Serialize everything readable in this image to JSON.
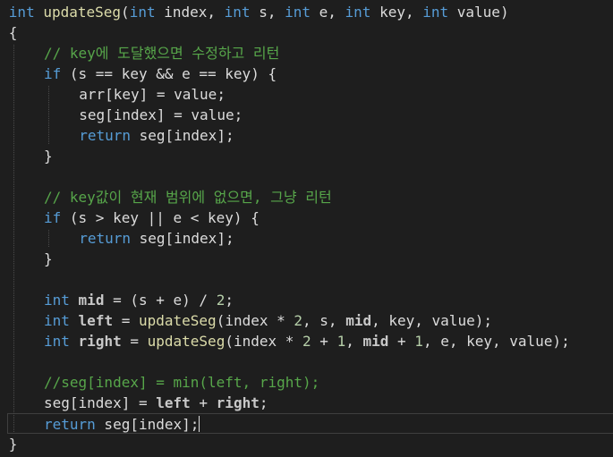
{
  "editor": {
    "lines": [
      {
        "indent": 1,
        "tokens": [
          {
            "t": "int",
            "c": "kw"
          },
          {
            "t": " ",
            "c": "pl"
          },
          {
            "t": "updateSeg",
            "c": "fn"
          },
          {
            "t": "(",
            "c": "pl"
          },
          {
            "t": "int",
            "c": "kw"
          },
          {
            "t": " index, ",
            "c": "pl"
          },
          {
            "t": "int",
            "c": "kw"
          },
          {
            "t": " s, ",
            "c": "pl"
          },
          {
            "t": "int",
            "c": "kw"
          },
          {
            "t": " e, ",
            "c": "pl"
          },
          {
            "t": "int",
            "c": "kw"
          },
          {
            "t": " key, ",
            "c": "pl"
          },
          {
            "t": "int",
            "c": "kw"
          },
          {
            "t": " value)",
            "c": "pl"
          }
        ]
      },
      {
        "indent": 1,
        "tokens": [
          {
            "t": "{",
            "c": "pl"
          }
        ]
      },
      {
        "indent": 5,
        "tokens": [
          {
            "t": "// key에 도달했으면 수정하고 리턴",
            "c": "cm"
          }
        ]
      },
      {
        "indent": 5,
        "tokens": [
          {
            "t": "if",
            "c": "kw"
          },
          {
            "t": " (s == key && e == key) {",
            "c": "pl"
          }
        ]
      },
      {
        "indent": 9,
        "tokens": [
          {
            "t": "arr[key] = value;",
            "c": "pl"
          }
        ]
      },
      {
        "indent": 9,
        "tokens": [
          {
            "t": "seg[index] = value;",
            "c": "pl"
          }
        ]
      },
      {
        "indent": 9,
        "tokens": [
          {
            "t": "return",
            "c": "kw"
          },
          {
            "t": " seg[index];",
            "c": "pl"
          }
        ]
      },
      {
        "indent": 5,
        "tokens": [
          {
            "t": "}",
            "c": "pl"
          }
        ]
      },
      {
        "indent": 0,
        "tokens": []
      },
      {
        "indent": 5,
        "tokens": [
          {
            "t": "// key값이 현재 범위에 없으면, 그냥 리턴",
            "c": "cm"
          }
        ]
      },
      {
        "indent": 5,
        "tokens": [
          {
            "t": "if",
            "c": "kw"
          },
          {
            "t": " (s > key || e < key) {",
            "c": "pl"
          }
        ]
      },
      {
        "indent": 9,
        "tokens": [
          {
            "t": "return",
            "c": "kw"
          },
          {
            "t": " seg[index];",
            "c": "pl"
          }
        ]
      },
      {
        "indent": 5,
        "tokens": [
          {
            "t": "}",
            "c": "pl"
          }
        ]
      },
      {
        "indent": 0,
        "tokens": []
      },
      {
        "indent": 5,
        "tokens": [
          {
            "t": "int",
            "c": "kw"
          },
          {
            "t": " ",
            "c": "pl"
          },
          {
            "t": "mid",
            "c": "lv"
          },
          {
            "t": " = (s + e) / ",
            "c": "pl"
          },
          {
            "t": "2",
            "c": "nm"
          },
          {
            "t": ";",
            "c": "pl"
          }
        ]
      },
      {
        "indent": 5,
        "tokens": [
          {
            "t": "int",
            "c": "kw"
          },
          {
            "t": " ",
            "c": "pl"
          },
          {
            "t": "left",
            "c": "lv"
          },
          {
            "t": " = ",
            "c": "pl"
          },
          {
            "t": "updateSeg",
            "c": "fn"
          },
          {
            "t": "(index * ",
            "c": "pl"
          },
          {
            "t": "2",
            "c": "nm"
          },
          {
            "t": ", s, ",
            "c": "pl"
          },
          {
            "t": "mid",
            "c": "lv"
          },
          {
            "t": ", key, value);",
            "c": "pl"
          }
        ]
      },
      {
        "indent": 5,
        "tokens": [
          {
            "t": "int",
            "c": "kw"
          },
          {
            "t": " ",
            "c": "pl"
          },
          {
            "t": "right",
            "c": "lv"
          },
          {
            "t": " = ",
            "c": "pl"
          },
          {
            "t": "updateSeg",
            "c": "fn"
          },
          {
            "t": "(index * ",
            "c": "pl"
          },
          {
            "t": "2",
            "c": "nm"
          },
          {
            "t": " + ",
            "c": "pl"
          },
          {
            "t": "1",
            "c": "nm"
          },
          {
            "t": ", ",
            "c": "pl"
          },
          {
            "t": "mid",
            "c": "lv"
          },
          {
            "t": " + ",
            "c": "pl"
          },
          {
            "t": "1",
            "c": "nm"
          },
          {
            "t": ", e, key, value);",
            "c": "pl"
          }
        ]
      },
      {
        "indent": 0,
        "tokens": []
      },
      {
        "indent": 5,
        "tokens": [
          {
            "t": "//seg[index] = min(left, right);",
            "c": "cm"
          }
        ]
      },
      {
        "indent": 5,
        "tokens": [
          {
            "t": "seg[index] = ",
            "c": "pl"
          },
          {
            "t": "left",
            "c": "lv"
          },
          {
            "t": " + ",
            "c": "pl"
          },
          {
            "t": "right",
            "c": "lv"
          },
          {
            "t": ";",
            "c": "pl"
          }
        ]
      },
      {
        "indent": 5,
        "current": true,
        "tokens": [
          {
            "t": "return",
            "c": "kw"
          },
          {
            "t": " seg[index];",
            "c": "pl"
          }
        ]
      },
      {
        "indent": 1,
        "tokens": [
          {
            "t": "}",
            "c": "pl"
          }
        ]
      }
    ]
  }
}
